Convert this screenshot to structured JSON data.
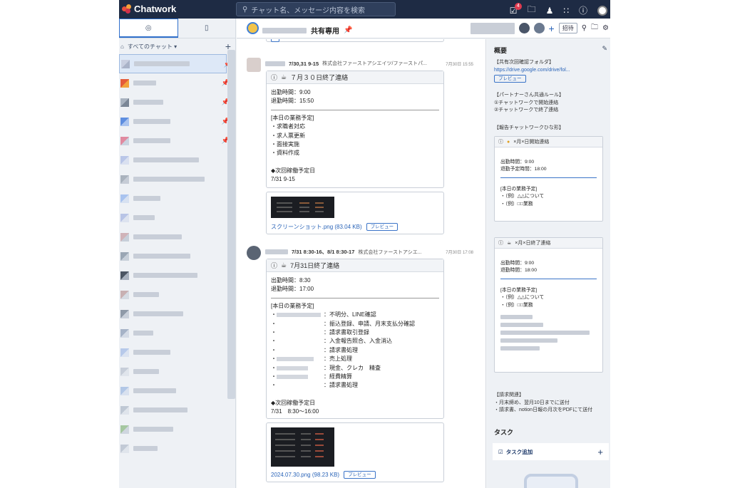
{
  "app": {
    "name": "Chatwork"
  },
  "topbar": {
    "search_placeholder": "チャット名、メッセージ内容を検索",
    "task_badge": "4"
  },
  "sidebar": {
    "header_label": "すべてのチャット ▾"
  },
  "room": {
    "title": "共有専用",
    "invite_label": "招待"
  },
  "messages": [
    {
      "subject": "7/30,31 9-15",
      "org": "株式会社ファーストアシエイツ/ファーストパ...",
      "time": "7月30日 15:55",
      "task_title": "７月３０日終了連絡",
      "lines": [
        "出勤時間：9:00",
        "退勤時間：15:50"
      ],
      "section_title": "[本日の業務予定]",
      "items": [
        "・求職者対応",
        "・求人票更新",
        "・面接実施",
        "・資料作成"
      ],
      "next_title": "◆次回稼働予定日",
      "next_value": "7/31  9-15",
      "attachment": "スクリーンショット.png (83.04 KB)",
      "preview": "プレビュー"
    },
    {
      "subject": "7/31 8:30-16、8/1 8:30-17",
      "org": "株式会社ファーストアシエ...",
      "time": "7月30日 17:08",
      "task_title": "7月31日終了連絡",
      "lines": [
        "出勤時間：8:30",
        "退勤時間：17:00"
      ],
      "section_title": "[本日の業務予定]",
      "items": [
        "：不明分、LINE確認",
        "：振込登録、申請、月末支払分確認",
        "：請求書取引登録",
        "：入金報告照合、入金消込",
        "：請求書処理",
        "：売上処理",
        "：現金、クレカ　精査",
        "：経費精算",
        "：請求書処理"
      ],
      "next_title": "◆次回稼働予定日",
      "next_value": "7/31　8:30～16:00",
      "attachment": "2024.07.30.png (98.23 KB)",
      "preview": "プレビュー"
    }
  ],
  "panel": {
    "summary_title": "概要",
    "folder_label": "【共有次回確認フォルダ】",
    "folder_link": "https://drive.google.com/drive/fol...",
    "preview": "プレビュー",
    "rules_title": "【パートナーさん共通ルール】",
    "rule1": "①チャットワークで開始連絡",
    "rule2": "②チャットワークで終了連絡",
    "template_title": "【報告チャットワークひな形】",
    "start_card": {
      "title": "×月×日開始連絡",
      "l1": "出勤時間：9:00",
      "l2": "退勤予定時間：18:00",
      "sec": "[本日の業務予定]",
      "i1": "・（例）△△について",
      "i2": "・（例）□□業務"
    },
    "end_card": {
      "title": "×月×日終了連絡",
      "l1": "出勤時間：9:00",
      "l2": "退勤時間：18:00",
      "sec": "[本日の業務予定]",
      "i1": "・（例）△△について",
      "i2": "・（例）□□業務"
    },
    "billing_title": "【請求関連】",
    "billing1": "・月末締め、翌月10日までに送付",
    "billing2": "・請求書、notion日報の月次をPDFにて送付",
    "task_section": "タスク",
    "task_add": "タスク追加"
  }
}
